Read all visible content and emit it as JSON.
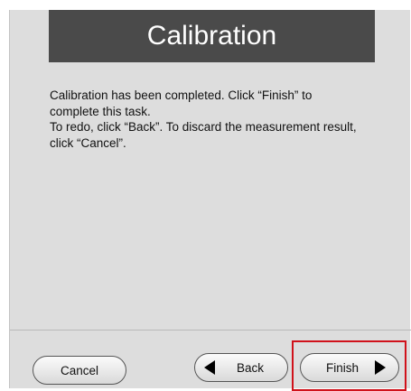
{
  "title": "Calibration",
  "message": {
    "line1": "Calibration has been completed. Click “Finish” to complete this task.",
    "line2": "To redo, click “Back”. To discard the measurement result, click “Cancel”."
  },
  "buttons": {
    "cancel": "Cancel",
    "back": "Back",
    "finish": "Finish"
  },
  "colors": {
    "title_bg": "#4a4a4a",
    "panel_bg": "#dddddd",
    "highlight": "#d0121b"
  },
  "icons": {
    "back": "left-triangle",
    "finish": "right-triangle"
  }
}
